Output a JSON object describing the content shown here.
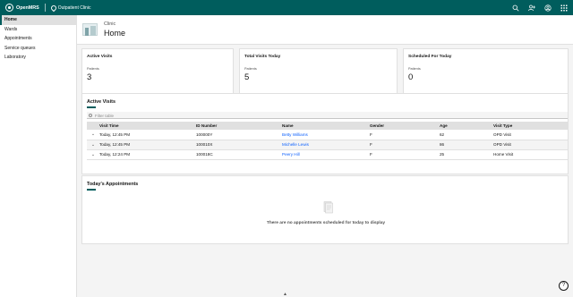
{
  "header": {
    "brand": "OpenMRS",
    "location": "Outpatient Clinic",
    "icons": [
      "search-icon",
      "add-patient-icon",
      "user-icon",
      "app-switcher-icon"
    ]
  },
  "sidebar": {
    "items": [
      {
        "label": "Home",
        "active": true
      },
      {
        "label": "Wards"
      },
      {
        "label": "Appointments"
      },
      {
        "label": "Service queues"
      },
      {
        "label": "Laboratory"
      }
    ]
  },
  "page": {
    "subtitle": "Clinic",
    "title": "Home"
  },
  "tiles": [
    {
      "title": "Active Visits",
      "label": "Patients",
      "value": "3"
    },
    {
      "title": "Total Visits Today",
      "label": "Patients",
      "value": "5"
    },
    {
      "title": "Scheduled For Today",
      "label": "Patients",
      "value": "0"
    }
  ],
  "active_visits": {
    "title": "Active Visits",
    "filter_placeholder": "Filter table",
    "columns": [
      "Visit Time",
      "ID Number",
      "Name",
      "Gender",
      "Age",
      "Visit Type"
    ],
    "rows": [
      {
        "time": "Today, 12:45 PM",
        "id": "100000Y",
        "name": "Betty Williams",
        "gender": "F",
        "age": "62",
        "type": "OPD Visit"
      },
      {
        "time": "Today, 12:45 PM",
        "id": "100010X",
        "name": "Michelle Lewis",
        "gender": "F",
        "age": "86",
        "type": "OPD Visit"
      },
      {
        "time": "Today, 12:24 PM",
        "id": "100018C",
        "name": "Peery Hill",
        "gender": "F",
        "age": "25",
        "type": "Home Visit"
      }
    ]
  },
  "appointments": {
    "title": "Today's Appointments",
    "empty_message": "There are no appointments scheduled for today to display"
  },
  "colors": {
    "header": "#005d5d",
    "link": "#0f62fe"
  }
}
